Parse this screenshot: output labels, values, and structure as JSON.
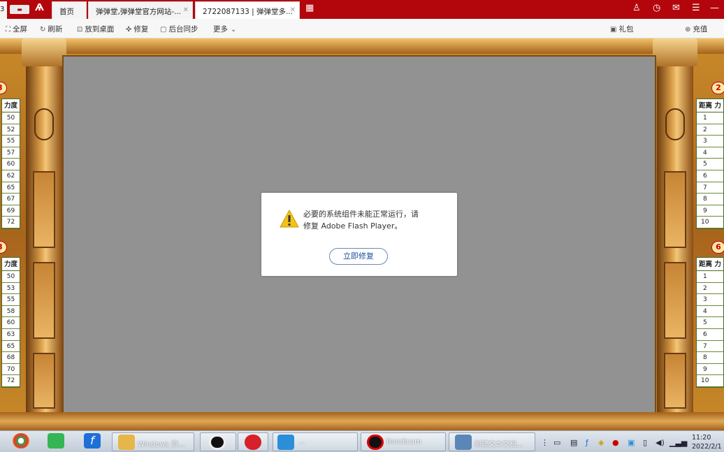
{
  "browser": {
    "tabs": [
      {
        "label": "3"
      },
      {
        "label": "首页"
      },
      {
        "label": "弹弹堂,弹弹堂官方网站-..."
      },
      {
        "label": "2722087133 | 弹弹堂多..."
      }
    ],
    "toolbar": {
      "fullscreen": "全屏",
      "refresh": "刷新",
      "desktop": "放到桌面",
      "repair": "修复",
      "background_sync": "后台同步",
      "more": "更多",
      "right_items": [
        "礼包",
        "充值"
      ]
    }
  },
  "game": {
    "left_tables": [
      {
        "badge": "3",
        "header": "力度",
        "values": [
          "50",
          "52",
          "55",
          "57",
          "60",
          "62",
          "65",
          "67",
          "69",
          "72"
        ]
      },
      {
        "badge": "3",
        "header": "力度",
        "values": [
          "50",
          "53",
          "55",
          "58",
          "60",
          "63",
          "65",
          "68",
          "70",
          "72"
        ]
      }
    ],
    "right_tables": [
      {
        "badge": "2",
        "header": "距离",
        "header2": "力",
        "values": [
          "1",
          "2",
          "3",
          "4",
          "5",
          "6",
          "7",
          "8",
          "9",
          "10"
        ]
      },
      {
        "badge": "6",
        "header": "距离",
        "header2": "力",
        "values": [
          "1",
          "2",
          "3",
          "4",
          "5",
          "6",
          "7",
          "8",
          "9",
          "10"
        ]
      }
    ]
  },
  "dialog": {
    "message_line1": "必要的系统组件未能正常运行，请",
    "message_line2": "修复 Adobe Flash Player。",
    "button_label": "立即修复"
  },
  "taskbar": {
    "items": [
      {
        "label": "",
        "color": "#2aa84a"
      },
      {
        "label": "",
        "color": "#35b553"
      },
      {
        "label": "",
        "color": "#1e6fd8"
      },
      {
        "label": "Windows 资...",
        "color": "#e5b64a"
      },
      {
        "label": "",
        "color": "#d11"
      },
      {
        "label": "",
        "color": "#d6202a"
      },
      {
        "label": "...",
        "color": "#2a8fd8"
      },
      {
        "label": "Bandicam",
        "color": "#c00"
      },
      {
        "label": "新建文本文档...",
        "color": "#5a86b8"
      }
    ],
    "clock_time": "11:20",
    "clock_date": "2022/2/1"
  }
}
